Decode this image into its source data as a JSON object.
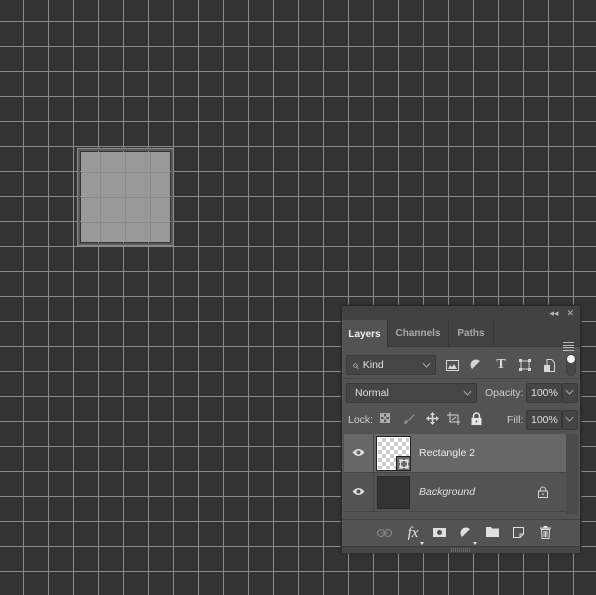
{
  "canvas": {
    "background": "#333333",
    "grid_color": "#8a8a8a",
    "shape_fill": "#999999"
  },
  "panel": {
    "header_icons": {
      "collapse": "collapse-icon",
      "close": "close-icon"
    },
    "collapse_glyph": "◂◂",
    "close_glyph": "✕",
    "tabs": [
      {
        "label": "Layers",
        "active": true
      },
      {
        "label": "Channels",
        "active": false
      },
      {
        "label": "Paths",
        "active": false
      }
    ],
    "filter": {
      "kind_label": "Kind",
      "search_glyph": "⌕",
      "icons": [
        "image-filter-icon",
        "adjustment-filter-icon",
        "type-filter-icon",
        "shape-filter-icon",
        "smart-object-filter-icon",
        "filter-toggle"
      ]
    },
    "blend": {
      "mode": "Normal",
      "opacity_label": "Opacity:",
      "opacity_value": "100%"
    },
    "lock": {
      "label": "Lock:",
      "fill_label": "Fill:",
      "fill_value": "100%"
    },
    "layers": [
      {
        "name": "Rectangle 2",
        "visible": true,
        "selected": true,
        "italic": false,
        "locked": false
      },
      {
        "name": "Background",
        "visible": true,
        "selected": false,
        "italic": true,
        "locked": true
      }
    ],
    "footer": {
      "fx_label": "fx"
    }
  }
}
